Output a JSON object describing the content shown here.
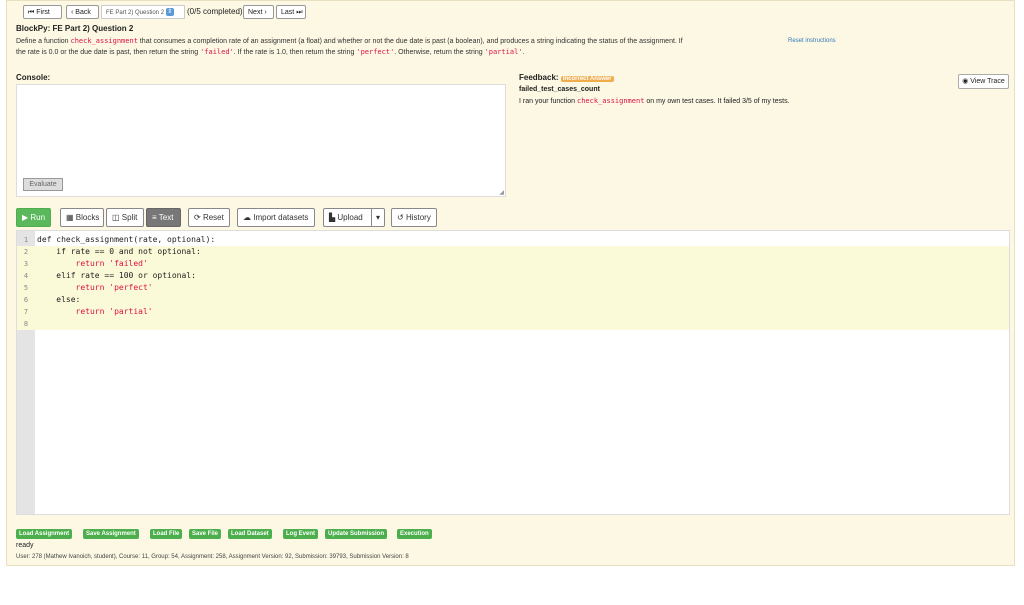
{
  "nav": {
    "first": "First",
    "back": "Back",
    "assignment_select": "FE Part 2) Question 2",
    "completed": "(0/5 completed)",
    "next": "Next",
    "last": "Last"
  },
  "header": {
    "title": "BlockPy: FE Part 2) Question 2",
    "desc_part1": "Define a function ",
    "func_name": "check_assignment",
    "desc_part2": " that consumes a completion rate of an assignment (a float) and whether or not the due date is past (a boolean), and produces a string indicating the status of the assignment. If",
    "reset_link": "Reset instructions",
    "desc_line2_a": "the rate is 0.0 or the due date is past, then return the string ",
    "failed_str": "'failed'",
    "desc_line2_b": ". If the rate is 1.0, then return the string ",
    "perfect_str": "'perfect'",
    "desc_line2_c": ". Otherwise, return the string ",
    "partial_str": "'partial'",
    "desc_line2_d": "."
  },
  "console": {
    "label": "Console:",
    "evaluate": "Evaluate"
  },
  "feedback": {
    "label": "Feedback:",
    "badge": "Incorrect Answer",
    "title": "failed_test_cases_count",
    "msg_a": "I ran your function ",
    "msg_func": "check_assignment",
    "msg_b": " on my own test cases. It failed 3/5 of my tests.",
    "view_trace": "View Trace"
  },
  "toolbar": {
    "run": "Run",
    "blocks": "Blocks",
    "split": "Split",
    "text": "Text",
    "reset": "Reset",
    "import": "Import datasets",
    "upload": "Upload",
    "history": "History"
  },
  "editor": {
    "line_numbers": [
      "1",
      "2",
      "3",
      "4",
      "5",
      "6",
      "7",
      "8"
    ],
    "lines": [
      "def check_assignment(rate, optional):",
      "    if rate == 0 and not optional:",
      "        return 'failed'",
      "    elif rate == 100 or optional:",
      "        return 'perfect'",
      "    else:",
      "        return 'partial'",
      ""
    ]
  },
  "bottom": {
    "buttons": [
      "Load Assignment",
      "Save Assignment",
      "Load File",
      "Save File",
      "Load Dataset",
      "Log Event",
      "Update Submission",
      "Execution"
    ],
    "status": "ready",
    "user_info": "User: 278 (Mathew Ivanoich, student), Course: 11, Group: 54, Assignment: 258, Assignment Version: 92, Submission: 39793, Submission Version: 8"
  },
  "colors": {
    "panel_bg": "#fcf8e3",
    "run_green": "#5cb85c",
    "badge_orange": "#f0ad4e",
    "code_red": "#d14",
    "highlight_yellow": "#fbfad8"
  }
}
